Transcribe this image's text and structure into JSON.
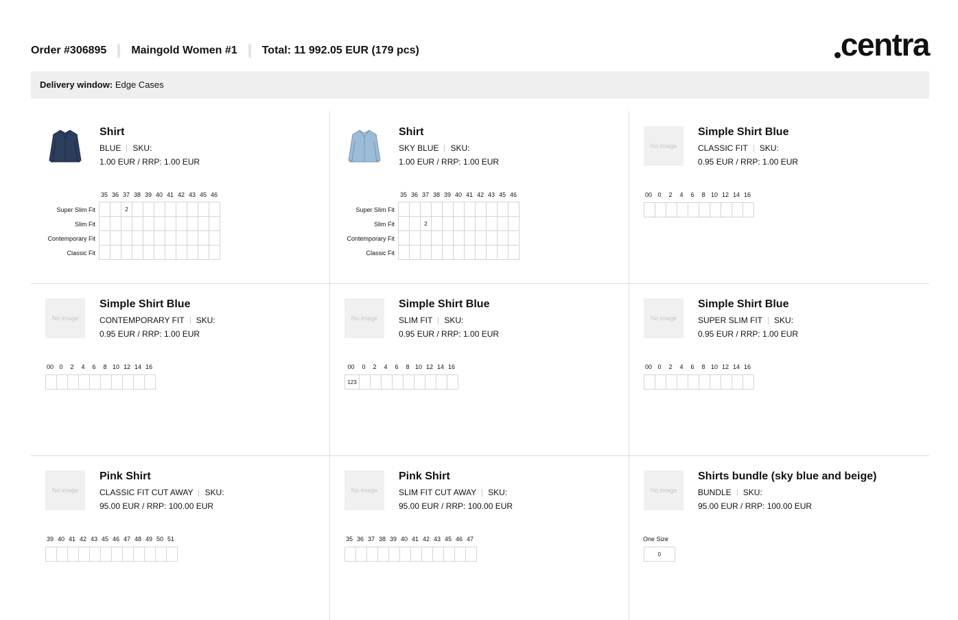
{
  "header": {
    "order": "Order #306895",
    "store": "Maingold Women #1",
    "total": "Total: 11 992.05 EUR (179 pcs)",
    "logo": "centra"
  },
  "delivery": {
    "label": "Delivery window:",
    "value": "Edge Cases"
  },
  "products": [
    {
      "title": "Shirt",
      "variant": "BLUE",
      "sku": "SKU:",
      "price": "1.00 EUR / RRP: 1.00 EUR",
      "image": "dark-blue-shirt-photo",
      "sizes": [
        "35",
        "36",
        "37",
        "38",
        "39",
        "40",
        "41",
        "42",
        "43",
        "45",
        "46"
      ],
      "rows": [
        {
          "label": "Super Slim Fit",
          "values": [
            "",
            "",
            "2",
            "",
            "",
            "",
            "",
            "",
            "",
            "",
            ""
          ]
        },
        {
          "label": "Slim Fit",
          "values": [
            "",
            "",
            "",
            "",
            "",
            "",
            "",
            "",
            "",
            "",
            ""
          ]
        },
        {
          "label": "Contemporary Fit",
          "values": [
            "",
            "",
            "",
            "",
            "",
            "",
            "",
            "",
            "",
            "",
            ""
          ]
        },
        {
          "label": "Classic Fit",
          "values": [
            "",
            "",
            "",
            "",
            "",
            "",
            "",
            "",
            "",
            "",
            ""
          ]
        }
      ]
    },
    {
      "title": "Shirt",
      "variant": "SKY BLUE",
      "sku": "SKU:",
      "price": "1.00 EUR / RRP: 1.00 EUR",
      "image": "sky-blue-shirt-photo",
      "sizes": [
        "35",
        "36",
        "37",
        "38",
        "39",
        "40",
        "41",
        "42",
        "43",
        "45",
        "46"
      ],
      "rows": [
        {
          "label": "Super Slim Fit",
          "values": [
            "",
            "",
            "",
            "",
            "",
            "",
            "",
            "",
            "",
            "",
            ""
          ]
        },
        {
          "label": "Slim Fit",
          "values": [
            "",
            "",
            "2",
            "",
            "",
            "",
            "",
            "",
            "",
            "",
            ""
          ]
        },
        {
          "label": "Contemporary Fit",
          "values": [
            "",
            "",
            "",
            "",
            "",
            "",
            "",
            "",
            "",
            "",
            ""
          ]
        },
        {
          "label": "Classic Fit",
          "values": [
            "",
            "",
            "",
            "",
            "",
            "",
            "",
            "",
            "",
            "",
            ""
          ]
        }
      ]
    },
    {
      "title": "Simple Shirt Blue",
      "variant": "CLASSIC FIT",
      "sku": "SKU:",
      "price": "0.95 EUR / RRP: 1.00 EUR",
      "image": "No image",
      "sizes": [
        "00",
        "0",
        "2",
        "4",
        "6",
        "8",
        "10",
        "12",
        "14",
        "16"
      ],
      "values": [
        "",
        "",
        "",
        "",
        "",
        "",
        "",
        "",
        "",
        ""
      ]
    },
    {
      "title": "Simple Shirt Blue",
      "variant": "CONTEMPORARY FIT",
      "sku": "SKU:",
      "price": "0.95 EUR / RRP: 1.00 EUR",
      "image": "No image",
      "sizes": [
        "00",
        "0",
        "2",
        "4",
        "6",
        "8",
        "10",
        "12",
        "14",
        "16"
      ],
      "values": [
        "",
        "",
        "",
        "",
        "",
        "",
        "",
        "",
        "",
        ""
      ]
    },
    {
      "title": "Simple Shirt Blue",
      "variant": "SLIM FIT",
      "sku": "SKU:",
      "price": "0.95 EUR / RRP: 1.00 EUR",
      "image": "No image",
      "sizes": [
        "00",
        "0",
        "2",
        "4",
        "6",
        "8",
        "10",
        "12",
        "14",
        "16"
      ],
      "values": [
        "123",
        "",
        "",
        "",
        "",
        "",
        "",
        "",
        "",
        ""
      ]
    },
    {
      "title": "Simple Shirt Blue",
      "variant": "SUPER SLIM FIT",
      "sku": "SKU:",
      "price": "0.95 EUR / RRP: 1.00 EUR",
      "image": "No image",
      "sizes": [
        "00",
        "0",
        "2",
        "4",
        "6",
        "8",
        "10",
        "12",
        "14",
        "16"
      ],
      "values": [
        "",
        "",
        "",
        "",
        "",
        "",
        "",
        "",
        "",
        ""
      ]
    },
    {
      "title": "Pink Shirt",
      "variant": "CLASSIC FIT CUT AWAY",
      "sku": "SKU:",
      "price": "95.00 EUR / RRP: 100.00 EUR",
      "image": "No image",
      "sizes": [
        "39",
        "40",
        "41",
        "42",
        "43",
        "45",
        "46",
        "47",
        "48",
        "49",
        "50",
        "51"
      ],
      "values": [
        "",
        "",
        "",
        "",
        "",
        "",
        "",
        "",
        "",
        "",
        "",
        ""
      ]
    },
    {
      "title": "Pink Shirt",
      "variant": "SLIM FIT CUT AWAY",
      "sku": "SKU:",
      "price": "95.00 EUR / RRP: 100.00 EUR",
      "image": "No image",
      "sizes": [
        "35",
        "36",
        "37",
        "38",
        "39",
        "40",
        "41",
        "42",
        "43",
        "45",
        "46",
        "47"
      ],
      "values": [
        "",
        "",
        "",
        "",
        "",
        "",
        "",
        "",
        "",
        "",
        "",
        ""
      ]
    },
    {
      "title": "Shirts bundle (sky blue and beige)",
      "variant": "BUNDLE",
      "sku": "SKU:",
      "price": "95.00 EUR / RRP: 100.00 EUR",
      "image": "No image",
      "sizes": [
        "One Size"
      ],
      "values": [
        "0"
      ]
    }
  ]
}
